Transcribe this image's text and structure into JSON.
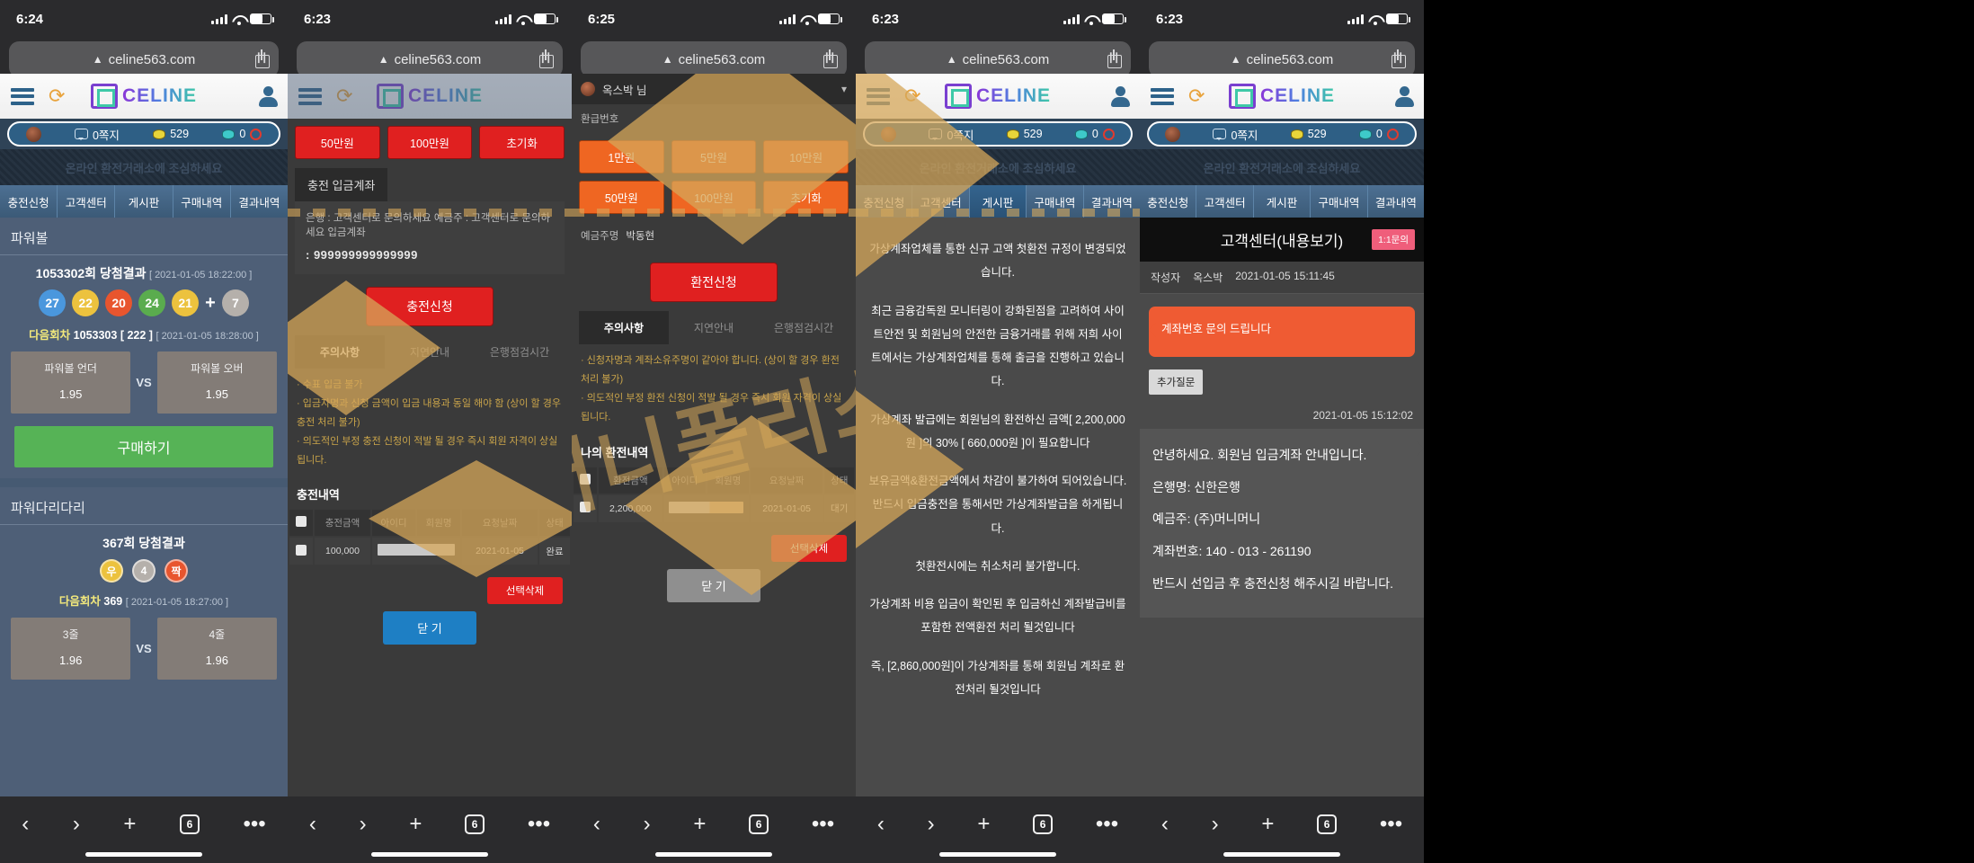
{
  "site": {
    "url": "celine563.com",
    "brand": "CELINE"
  },
  "phones": [
    {
      "time": "6:24"
    },
    {
      "time": "6:23"
    },
    {
      "time": "6:25"
    },
    {
      "time": "6:23"
    },
    {
      "time": "6:23"
    }
  ],
  "info_pill": {
    "msg": "0쪽지",
    "point": "529",
    "cash": "0"
  },
  "marquee": "온라인 환전거래소에 조심하세요",
  "nav": [
    "충전신청",
    "고객센터",
    "게시판",
    "구매내역",
    "결과내역"
  ],
  "game": {
    "powerball": {
      "title": "파워볼",
      "round_label": "1053302회 당첨결과",
      "round_date": "[ 2021-01-05 18:22:00 ]",
      "balls": [
        {
          "n": "27",
          "color": "#4a97dd"
        },
        {
          "n": "22",
          "color": "#ecc23e"
        },
        {
          "n": "20",
          "color": "#e8552e"
        },
        {
          "n": "24",
          "color": "#5aac4e"
        },
        {
          "n": "21",
          "color": "#ecc23e"
        }
      ],
      "plus": "+",
      "power": {
        "n": "7",
        "color": "#b5b0ab"
      },
      "next_label": "다음회차",
      "next_round": "1053303",
      "next_count": "[ 222 ]",
      "next_date": "[ 2021-01-05 18:28:00 ]",
      "left_name": "파워볼 언더",
      "left_odd": "1.95",
      "vs": "VS",
      "right_name": "파워볼 오버",
      "right_odd": "1.95",
      "buy": "구매하기"
    },
    "ladder": {
      "title": "파워다리다리",
      "round_label": "367회 당첨결과",
      "marks": [
        {
          "n": "우",
          "color": "#ecc23e"
        },
        {
          "n": "4",
          "color": "#b5b0ab"
        },
        {
          "n": "짝",
          "color": "#e8552e"
        }
      ],
      "next_label": "다음회차",
      "next_round": "369",
      "next_date": "[ 2021-01-05 18:27:00 ]",
      "left_name": "3줄",
      "left_odd": "1.96",
      "vs": "VS",
      "right_name": "4줄",
      "right_odd": "1.96"
    }
  },
  "charge": {
    "amounts_top": [
      "50만원",
      "100만원",
      "초기화"
    ],
    "account_header": "충전 입금계좌",
    "bank_line": "은행 : 고객센터로 문의하세요   예금주 : 고객센터로 문의하세요   입금계좌",
    "account_number": ": 999999999999999",
    "submit": "충전신청",
    "tabs": [
      "주의사항",
      "지연안내",
      "은행점검시간"
    ],
    "notes": [
      "·   수표 입금 불가",
      "·   입금자명과 신청 금액이 입금 내용과 동일 해야 함 (상이 할 경우 충전 처리 불가)",
      "·   의도적인 부정 충전 신청이 적발 될 경우 즉시 회원 자격이 상실 됩니다."
    ],
    "history_title": "충전내역",
    "columns": [
      "충전금액",
      "아이디",
      "회원명",
      "요청날짜",
      "상태"
    ],
    "rows": [
      {
        "amount": "100,000",
        "id": "",
        "name": "",
        "date": "2021-01-05",
        "status": "완료"
      }
    ],
    "delete": "선택삭제",
    "close": "닫 기"
  },
  "exchange": {
    "select_label": "옥스박 님",
    "field_label": "환급번호",
    "amounts_row1": [
      "1만원",
      "5만원",
      "10만원"
    ],
    "amounts_row2": [
      "50만원",
      "100만원",
      "초기화"
    ],
    "name_label": "예금주명",
    "name_value": "박동현",
    "submit": "환전신청",
    "tabs": [
      "주의사항",
      "지연안내",
      "은행점검시간"
    ],
    "notes": [
      "·   신청자명과 계좌소유주명이 같아야 합니다. (상이 할 경우 환전 처리 불가)",
      "·   의도적인 부정 환전 신청이 적발 될 경우 즉시 회원 자격이 상실 됩니다."
    ],
    "history_title": "나의 환전내역",
    "columns": [
      "환전금액",
      "아이디",
      "회원명",
      "요청날짜",
      "상태"
    ],
    "rows": [
      {
        "amount": "2,200,000",
        "id": "",
        "name": "",
        "date": "2021-01-05",
        "status": "대기"
      }
    ],
    "delete": "선택삭제",
    "close": "닫 기"
  },
  "notice": {
    "lines": [
      "가상계좌업체를 통한 신규 고액 첫환전 규정이 변경되었습니다.",
      "최근 금융감독원 모니터링이 강화된점을 고려하여 사이트안전 및 회원님의 안전한 금융거래를 위해 저희 사이트에서는 가상계좌업체를 통해 출금을 진행하고 있습니다.",
      "가상계좌 발급에는 회원님의 환전하신 금액[ 2,200,000원 ]의 30% [ 660,000원 ]이 필요합니다",
      "보유금액&환전금액에서 차감이 불가하여 되어있습니다.반드시 입금충전을 통해서만 가상계좌발급을 하게됩니다.",
      "첫환전시에는 취소처리 불가합니다.",
      "가상계좌 비용 입금이 확인된 후 입금하신 계좌발급비를 포함한 전액환전 처리 될것입니다",
      "즉, [2,860,000원]이 가상계좌를 통해 회원님 계좌로 환전처리 될것입니다"
    ]
  },
  "cs": {
    "title": "고객센터(내용보기)",
    "badge": "1:1문의",
    "author_label": "작성자",
    "author": "옥스박",
    "date": "2021-01-05 15:11:45",
    "question": "계좌번호 문의 드립니다",
    "add_question": "추가질문",
    "answer_time": "2021-01-05 15:12:02",
    "answer_lines": [
      "안녕하세요. 회원님 입금계좌 안내입니다.",
      "은행명: 신한은행",
      "예금주: (주)머니머니",
      "계좌번호: 140 - 013 - 261190",
      "반드시 선입금 후   충전신청 해주시길 바랍니다."
    ]
  },
  "watermark": "머니폴리스",
  "tabbar": {
    "back": "‹",
    "fwd": "›",
    "add": "+",
    "count": "6",
    "more": "•••"
  }
}
